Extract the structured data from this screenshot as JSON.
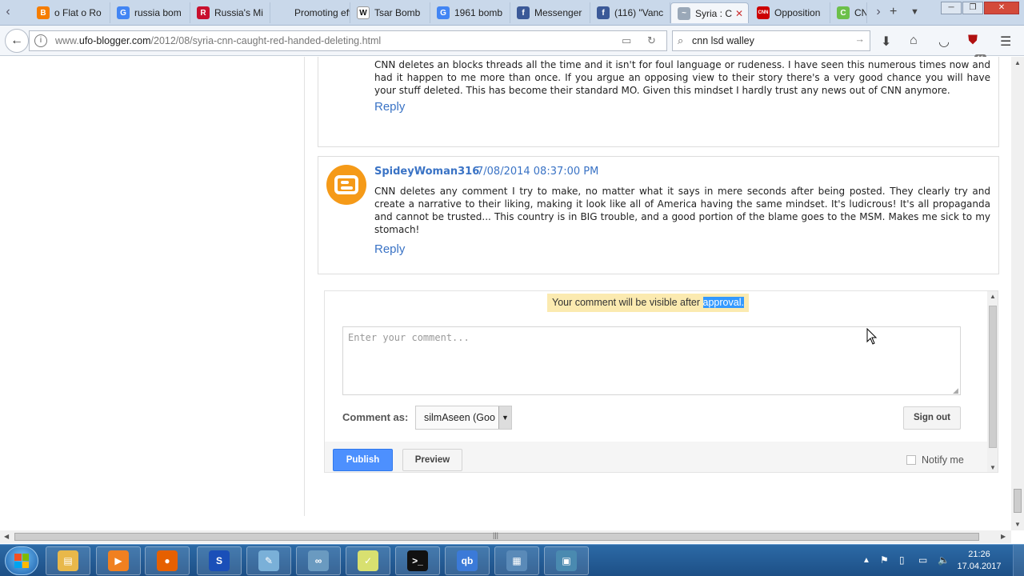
{
  "browser": {
    "tabs": [
      {
        "title": "o Flat o Ro",
        "icon": "blogger-icon",
        "color": "#f57d00",
        "glyph": "B"
      },
      {
        "title": "russia bom",
        "icon": "google-icon",
        "color": "#4285f4",
        "glyph": "G"
      },
      {
        "title": "Russia's Mi",
        "icon": "rt-icon",
        "color": "#c8102e",
        "glyph": "R"
      },
      {
        "title": "Promoting effo",
        "icon": "blank-page-icon",
        "color": "#c9d8ea",
        "glyph": ""
      },
      {
        "title": "Tsar Bomb",
        "icon": "wikipedia-icon",
        "color": "#ffffff",
        "glyph": "W"
      },
      {
        "title": "1961 bomb",
        "icon": "google-icon",
        "color": "#4285f4",
        "glyph": "G"
      },
      {
        "title": "Messenger",
        "icon": "facebook-icon",
        "color": "#3b5998",
        "glyph": "f"
      },
      {
        "title": "(116) \"Vanc",
        "icon": "facebook-icon",
        "color": "#3b5998",
        "glyph": "f"
      },
      {
        "title": "Syria : C",
        "icon": "ufo-blogger-icon",
        "color": "#9aa8b8",
        "glyph": "~"
      },
      {
        "title": "Opposition",
        "icon": "cnn-icon",
        "color": "#cc0000",
        "glyph": "CNN"
      },
      {
        "title": "CNI",
        "icon": "green-icon",
        "color": "#6cc04a",
        "glyph": "C"
      }
    ],
    "url_prefix": "www.",
    "url_domain": "ufo-blogger.com",
    "url_path": "/2012/08/syria-cnn-caught-red-handed-deleting.html",
    "search_value": "cnn lsd walley",
    "addon_badge": "11"
  },
  "comments": [
    {
      "text": "CNN deletes an blocks threads all the time and it isn't for foul language or rudeness. I have seen this numerous times now and had it happen to me more than once. If you argue an opposing view to their story there's a very good chance you will have your stuff deleted. This has become their standard MO. Given this mindset I hardly trust any news out of CNN anymore.",
      "reply": "Reply"
    },
    {
      "author": "SpideyWoman316",
      "time": "7/08/2014 08:37:00 PM",
      "text": "CNN deletes any comment I try to make, no matter what it says in mere seconds after being posted. They clearly try and create a narrative to their liking, making it look like all of America having the same mindset. It's ludicrous! It's all propaganda and cannot be trusted... This country is in BIG trouble, and a good portion of the blame goes to the MSM. Makes me sick to my stomach!",
      "reply": "Reply"
    }
  ],
  "comment_form": {
    "approval_prefix": "Your comment will be visible after ",
    "approval_highlight": "approval.",
    "placeholder": "Enter your comment...",
    "comment_as_label": "Comment as:",
    "identity": "silmAseen (Goo",
    "sign_out": "Sign out",
    "publish": "Publish",
    "preview": "Preview",
    "notify": "Notify me"
  },
  "taskbar": {
    "apps": [
      {
        "name": "file-explorer-icon",
        "color": "#e8b84a",
        "glyph": "▤"
      },
      {
        "name": "media-player-icon",
        "color": "#f08020",
        "glyph": "▶"
      },
      {
        "name": "firefox-icon",
        "color": "#e66000",
        "glyph": "●"
      },
      {
        "name": "skype-icon",
        "color": "#1a4fb8",
        "glyph": "S"
      },
      {
        "name": "notepad-icon",
        "color": "#7ab0d8",
        "glyph": "✎"
      },
      {
        "name": "network-tool-icon",
        "color": "#6a9ac0",
        "glyph": "∞"
      },
      {
        "name": "chart-editor-icon",
        "color": "#d8e070",
        "glyph": "✓"
      },
      {
        "name": "command-prompt-icon",
        "color": "#111111",
        "glyph": ">_"
      },
      {
        "name": "qbittorrent-icon",
        "color": "#3b7ad8",
        "glyph": "qb"
      },
      {
        "name": "calculator-icon",
        "color": "#5a8ab8",
        "glyph": "▦"
      },
      {
        "name": "image-viewer-icon",
        "color": "#4a8ab0",
        "glyph": "▣"
      }
    ],
    "time": "21:26",
    "date": "17.04.2017"
  }
}
